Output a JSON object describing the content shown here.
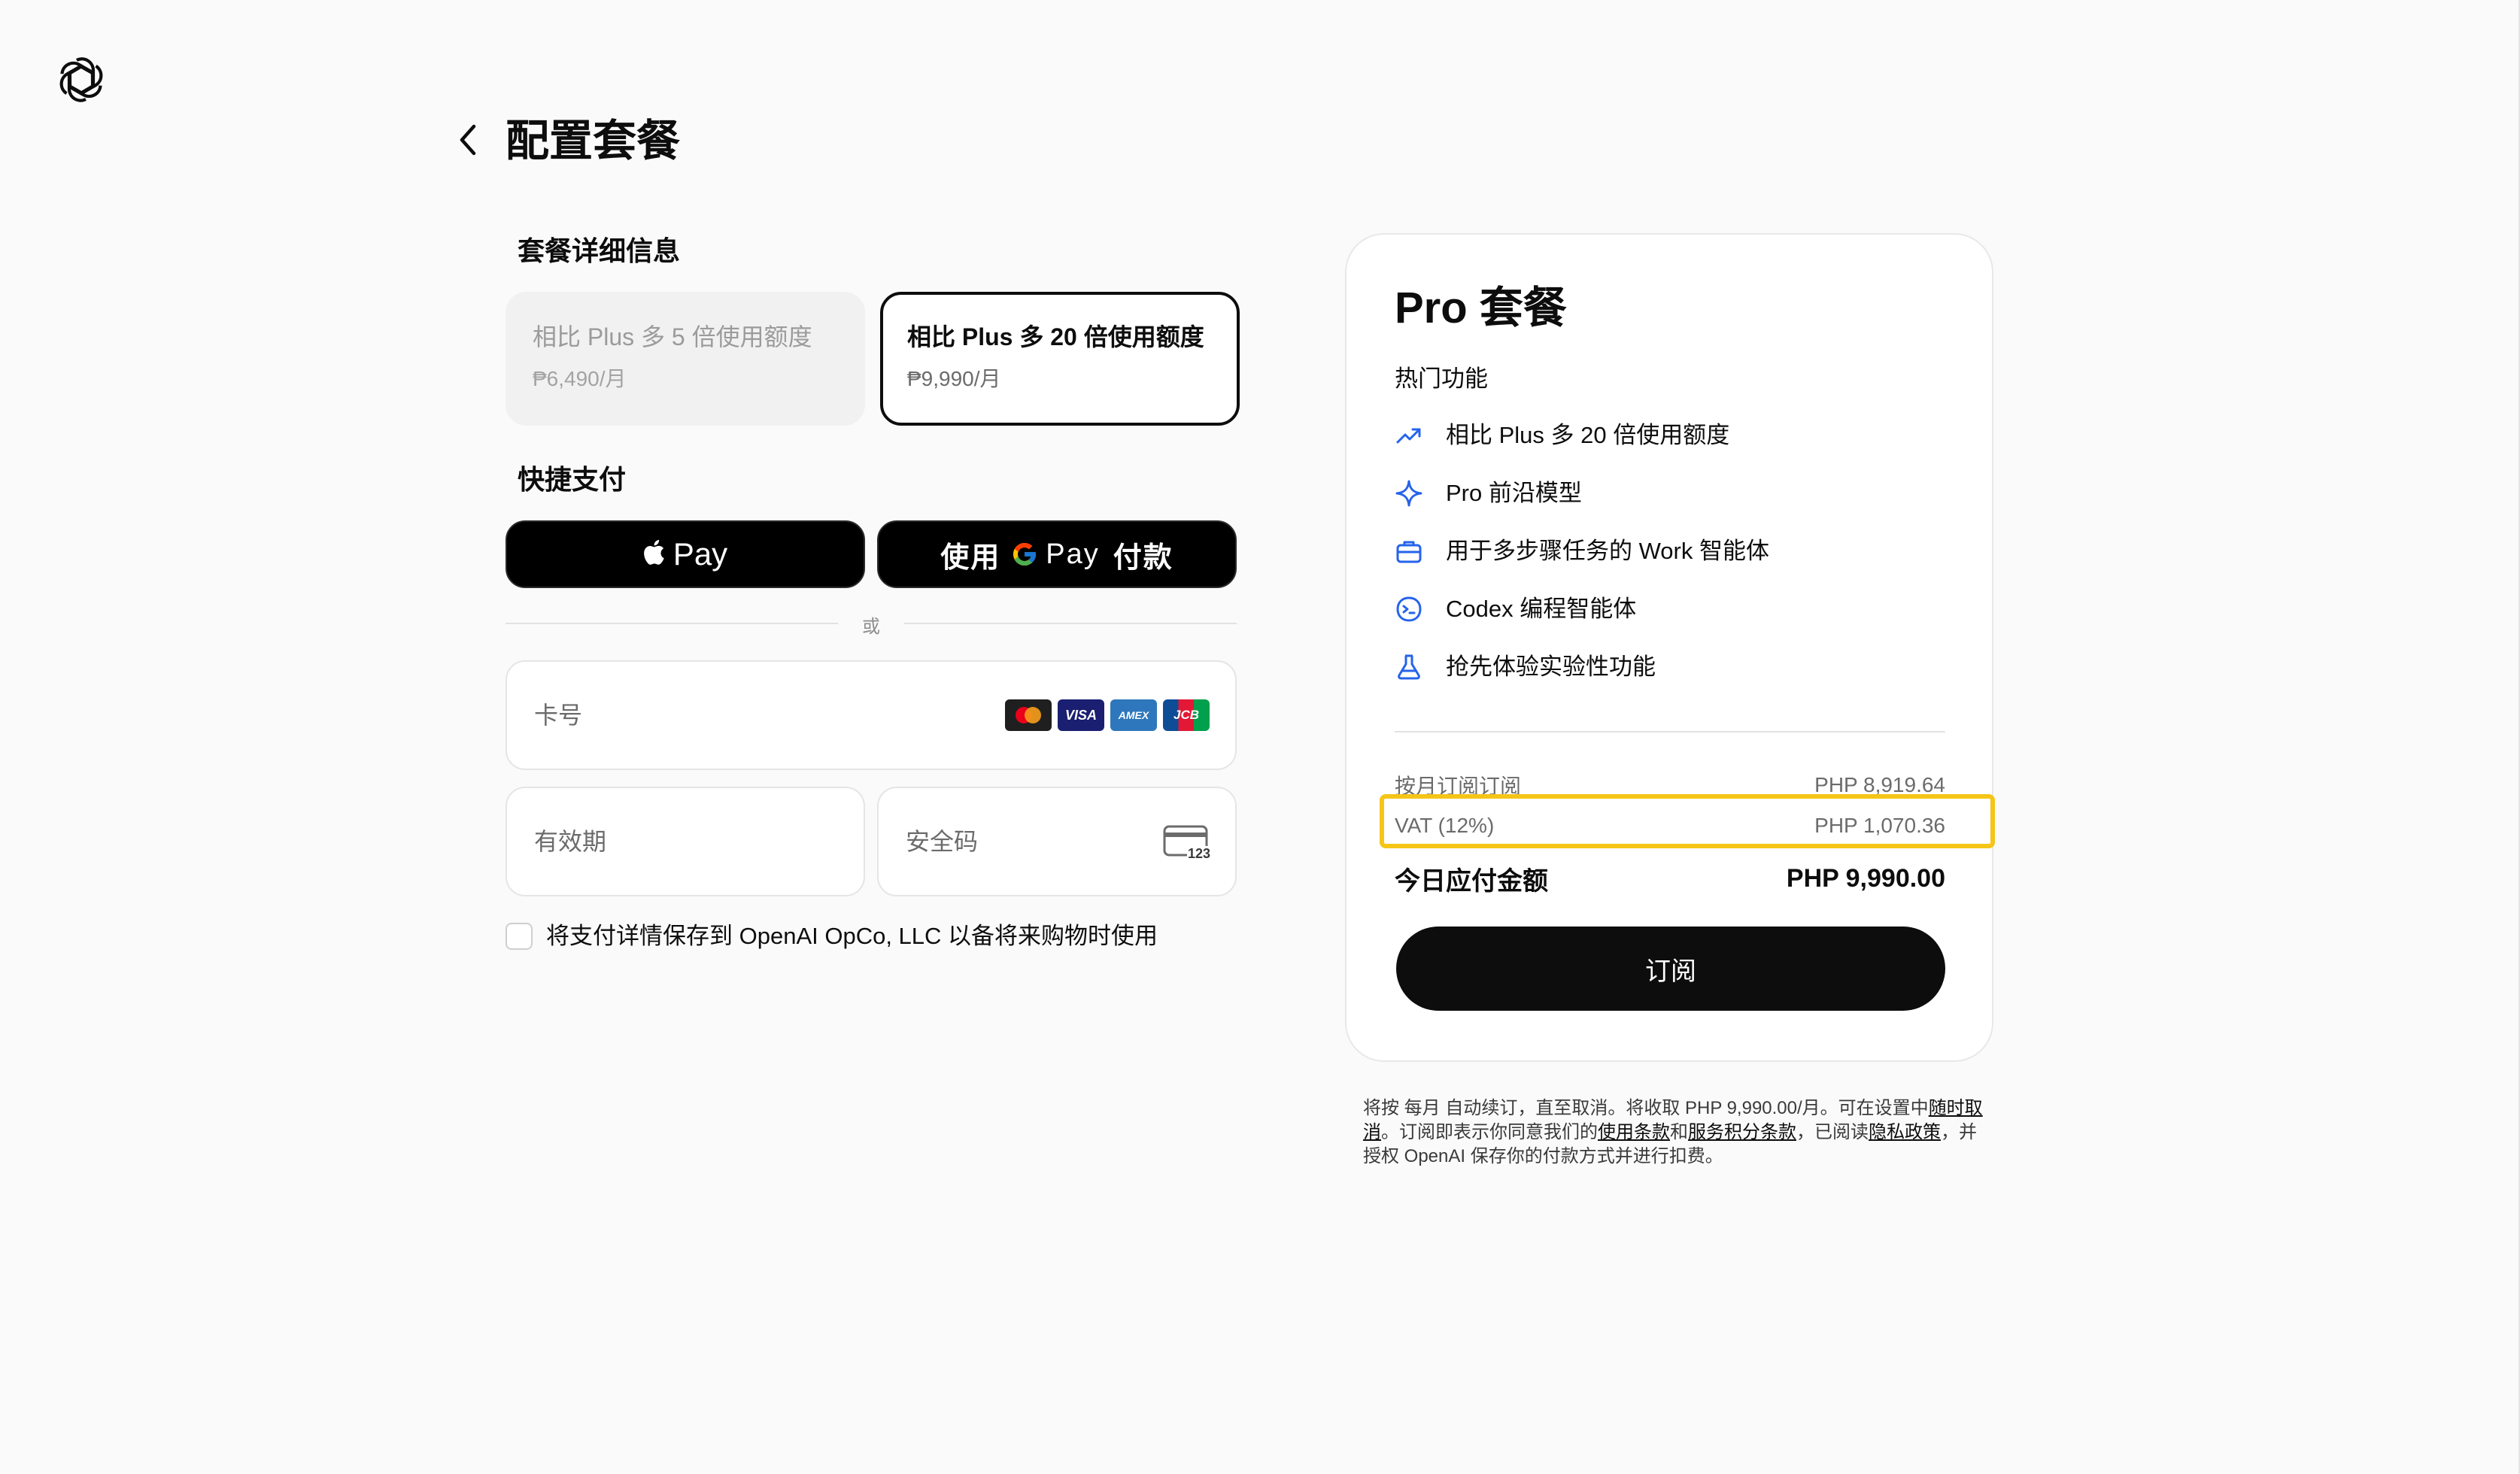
{
  "header": {
    "title": "配置套餐"
  },
  "plan_details": {
    "title": "套餐详细信息",
    "options": [
      {
        "label": "相比 Plus 多 5 倍使用额度",
        "price": "₱6,490/月",
        "selected": false
      },
      {
        "label": "相比 Plus 多 20 倍使用额度",
        "price": "₱9,990/月",
        "selected": true
      }
    ]
  },
  "quick_pay": {
    "title": "快捷支付",
    "apple_pay_label": "Pay",
    "google_pay_prefix": "使用",
    "google_pay_word": "Pay",
    "google_pay_suffix": "付款"
  },
  "divider": {
    "text": "或"
  },
  "card_form": {
    "card_number_placeholder": "卡号",
    "expiry_placeholder": "有效期",
    "cvc_placeholder": "安全码",
    "card_brands": [
      "mastercard-icon",
      "visa-icon",
      "amex-icon",
      "jcb-icon"
    ],
    "visa_text": "VISA",
    "amex_text": "AMEX",
    "jcb_text": "JCB",
    "cvc_icon_text": "123"
  },
  "save_details": {
    "label": "将支付详情保存到 OpenAI OpCo, LLC 以备将来购物时使用",
    "checked": false
  },
  "summary": {
    "plan_name": "Pro 套餐",
    "features_heading": "热门功能",
    "features": [
      {
        "icon": "trend-up-icon",
        "label": "相比 Plus 多 20 倍使用额度"
      },
      {
        "icon": "sparkle-icon",
        "label": "Pro 前沿模型"
      },
      {
        "icon": "briefcase-icon",
        "label": "用于多步骤任务的 Work 智能体"
      },
      {
        "icon": "codex-icon",
        "label": "Codex 编程智能体"
      },
      {
        "icon": "flask-icon",
        "label": "抢先体验实验性功能"
      }
    ],
    "rows": [
      {
        "label": "按月订阅订阅",
        "value": "PHP 8,919.64"
      },
      {
        "label": "VAT (12%)",
        "value": "PHP 1,070.36"
      }
    ],
    "total": {
      "label": "今日应付金额",
      "value": "PHP 9,990.00"
    },
    "subscribe_label": "订阅"
  },
  "legal": {
    "t1": "将按 每月 自动续订，直至取消。将收取 PHP 9,990.00/月。可在设置中",
    "link_cancel": "随时取消",
    "t2": "。订阅即表示你同意我们的",
    "link_terms": "使用条款",
    "t3": "和",
    "link_credits": "服务积分条款",
    "t4": "，已阅读",
    "link_privacy": "隐私政策",
    "t5": "，并授权 OpenAI 保存你的付款方式并进行扣费。"
  },
  "colors": {
    "accent": "#0d0d0d",
    "highlight": "#f5c518",
    "feature_icon": "#2563eb"
  }
}
